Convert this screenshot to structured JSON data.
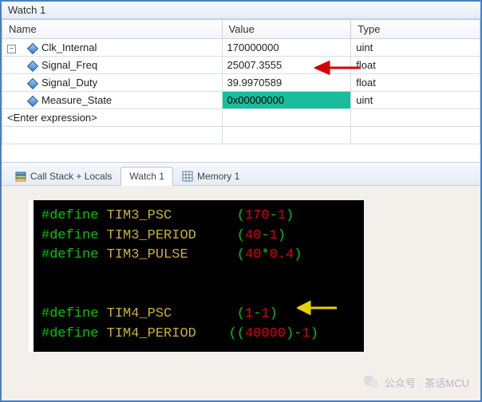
{
  "window": {
    "title": "Watch 1"
  },
  "columns": {
    "name": "Name",
    "value": "Value",
    "type": "Type"
  },
  "rows": [
    {
      "name": "Clk_Internal",
      "value": "170000000",
      "type": "uint"
    },
    {
      "name": "Signal_Freq",
      "value": "25007.3555",
      "type": "float"
    },
    {
      "name": "Signal_Duty",
      "value": "39.9970589",
      "type": "float"
    },
    {
      "name": "Measure_State",
      "value": "0x00000000",
      "type": "uint",
      "selected": true
    }
  ],
  "enter_expression": "<Enter expression>",
  "tabs": {
    "callstack": "Call Stack + Locals",
    "watch": "Watch 1",
    "memory": "Memory 1"
  },
  "code": {
    "l1_kw": "#define",
    "l1_id": "TIM3_PSC",
    "l1_exp_open": "(",
    "l1_n1": "170",
    "l1_op": "-",
    "l1_n2": "1",
    "l1_close": ")",
    "l2_kw": "#define",
    "l2_id": "TIM3_PERIOD",
    "l2_exp_open": "(",
    "l2_n1": "40",
    "l2_op": "-",
    "l2_n2": "1",
    "l2_close": ")",
    "l3_kw": "#define",
    "l3_id": "TIM3_PULSE",
    "l3_exp_open": "(",
    "l3_n1": "40",
    "l3_op": "*",
    "l3_n2": "0.4",
    "l3_close": ")",
    "l4_kw": "#define",
    "l4_id": "TIM4_PSC",
    "l4_exp_open": "(",
    "l4_n1": "1",
    "l4_op": "-",
    "l4_n2": "1",
    "l4_close": ")",
    "l5_kw": "#define",
    "l5_id": "TIM4_PERIOD",
    "l5_open": "((",
    "l5_n1": "40000",
    "l5_mid": ")-",
    "l5_n2": "1",
    "l5_close": ")"
  },
  "watermark": "公众号 · 茶话MCU",
  "chart_data": {
    "type": "table",
    "title": "Watch 1",
    "columns": [
      "Name",
      "Value",
      "Type"
    ],
    "rows": [
      [
        "Clk_Internal",
        "170000000",
        "uint"
      ],
      [
        "Signal_Freq",
        "25007.3555",
        "float"
      ],
      [
        "Signal_Duty",
        "39.9970589",
        "float"
      ],
      [
        "Measure_State",
        "0x00000000",
        "uint"
      ]
    ]
  }
}
